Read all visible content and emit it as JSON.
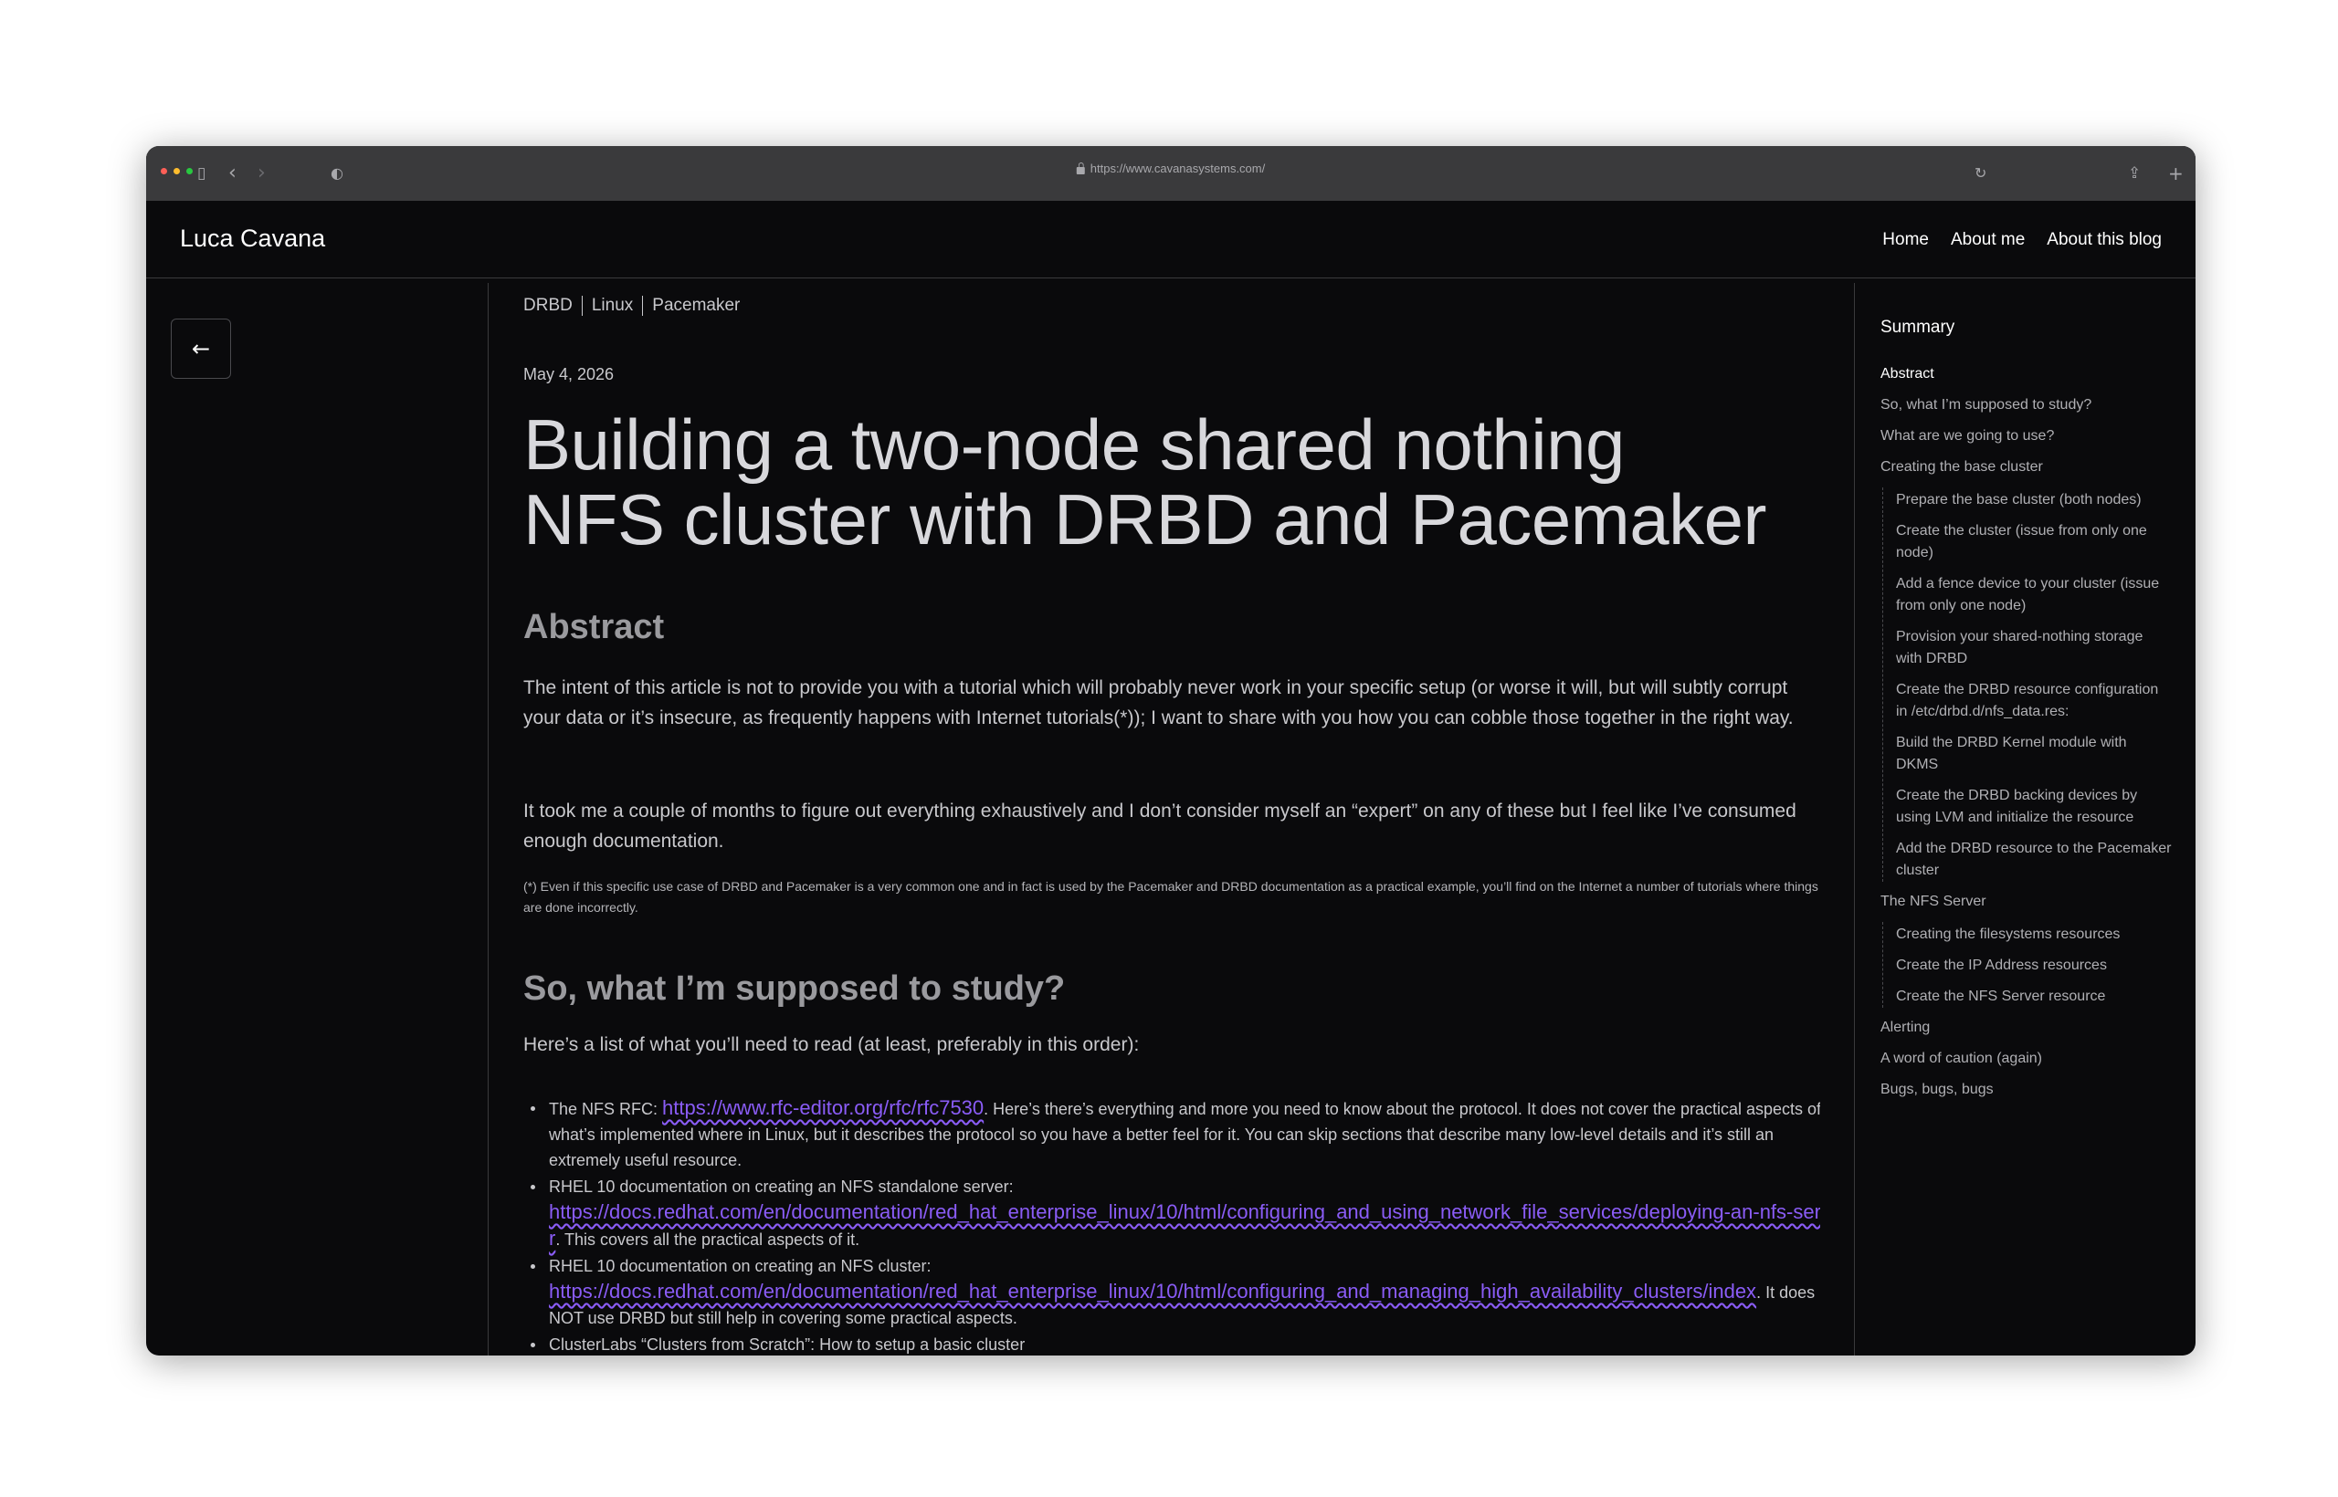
{
  "browser": {
    "url": "https://www.cavanasystems.com/",
    "traffic_colors": [
      "#ff5f57",
      "#febc2e",
      "#28c840"
    ]
  },
  "site": {
    "title": "Luca Cavana",
    "nav": [
      "Home",
      "About me",
      "About this blog"
    ]
  },
  "article": {
    "tags": [
      "DRBD",
      "Linux",
      "Pacemaker"
    ],
    "date": "May 4, 2026",
    "title_line1": "Building a two-node shared nothing",
    "title_line2": "NFS cluster with DRBD and Pacemaker",
    "abstract_heading": "Abstract",
    "abstract_p1": "The intent of this article is not to provide you with a tutorial which will probably never work in your specific setup (or worse it will, but will subtly corrupt your data or it’s insecure, as frequently happens with Internet tutorials(*)); I want to share with you how you can cobble those together in the right way.",
    "abstract_p2": "It took me a couple of months to figure out everything exhaustively and I don’t consider myself an “expert” on any of these but I feel like I’ve consumed enough documentation.",
    "footnote": "(*) Even if this specific use case of DRBD and Pacemaker is a very common one and in fact is used by the Pacemaker and DRBD documentation as a practical example, you’ll find on the Internet a number of tutorials where things are done incorrectly.",
    "study_heading": "So, what I’m supposed to study?",
    "study_intro": "Here’s a list of what you’ll need to read (at least, preferably in this order):",
    "list": [
      {
        "before": "The NFS RFC: ",
        "link": "https://www.rfc-editor.org/rfc/rfc7530",
        "after": ". Here’s there’s everything and more you need to know about the protocol. It does not cover the practical aspects of what’s implemented where in Linux, but it describes the protocol so you have a better feel for it. You can skip sections that describe many low-level details and it’s still an extremely useful resource."
      },
      {
        "before": "RHEL 10 documentation on creating an NFS standalone server:",
        "link": "https://docs.redhat.com/en/documentation/red_hat_enterprise_linux/10/html/configuring_and_using_network_file_services/deploying-an-nfs-server",
        "after": ". This covers all the practical aspects of it."
      },
      {
        "before": "RHEL 10 documentation on creating an NFS cluster:",
        "link": "https://docs.redhat.com/en/documentation/red_hat_enterprise_linux/10/html/configuring_and_managing_high_availability_clusters/index",
        "after": ". It does NOT use DRBD but still help in covering some practical aspects."
      },
      {
        "before": "ClusterLabs “Clusters from Scratch”: How to setup a basic cluster",
        "link": "",
        "after": ""
      }
    ],
    "link_color": "#8a5cf6"
  },
  "summary": {
    "title": "Summary",
    "items": {
      "abstract": "Abstract",
      "study": "So, what I’m supposed to study?",
      "use": "What are we going to use?",
      "base": "Creating the base cluster",
      "base_sub": [
        "Prepare the base cluster (both nodes)",
        "Create the cluster (issue from only one node)",
        "Add a fence device to your cluster (issue from only one node)",
        "Provision your shared-nothing storage with DRBD",
        "Create the DRBD resource configuration in /etc/drbd.d/nfs_data.res:",
        "Build the DRBD Kernel module with DKMS",
        "Create the DRBD backing devices by using LVM and initialize the resource",
        "Add the DRBD resource to the Pacemaker cluster"
      ],
      "nfs": "The NFS Server",
      "nfs_sub": [
        "Creating the filesystems resources",
        "Create the IP Address resources",
        "Create the NFS Server resource"
      ],
      "alerting": "Alerting",
      "caution": "A word of caution (again)",
      "bugs": "Bugs, bugs, bugs"
    }
  }
}
